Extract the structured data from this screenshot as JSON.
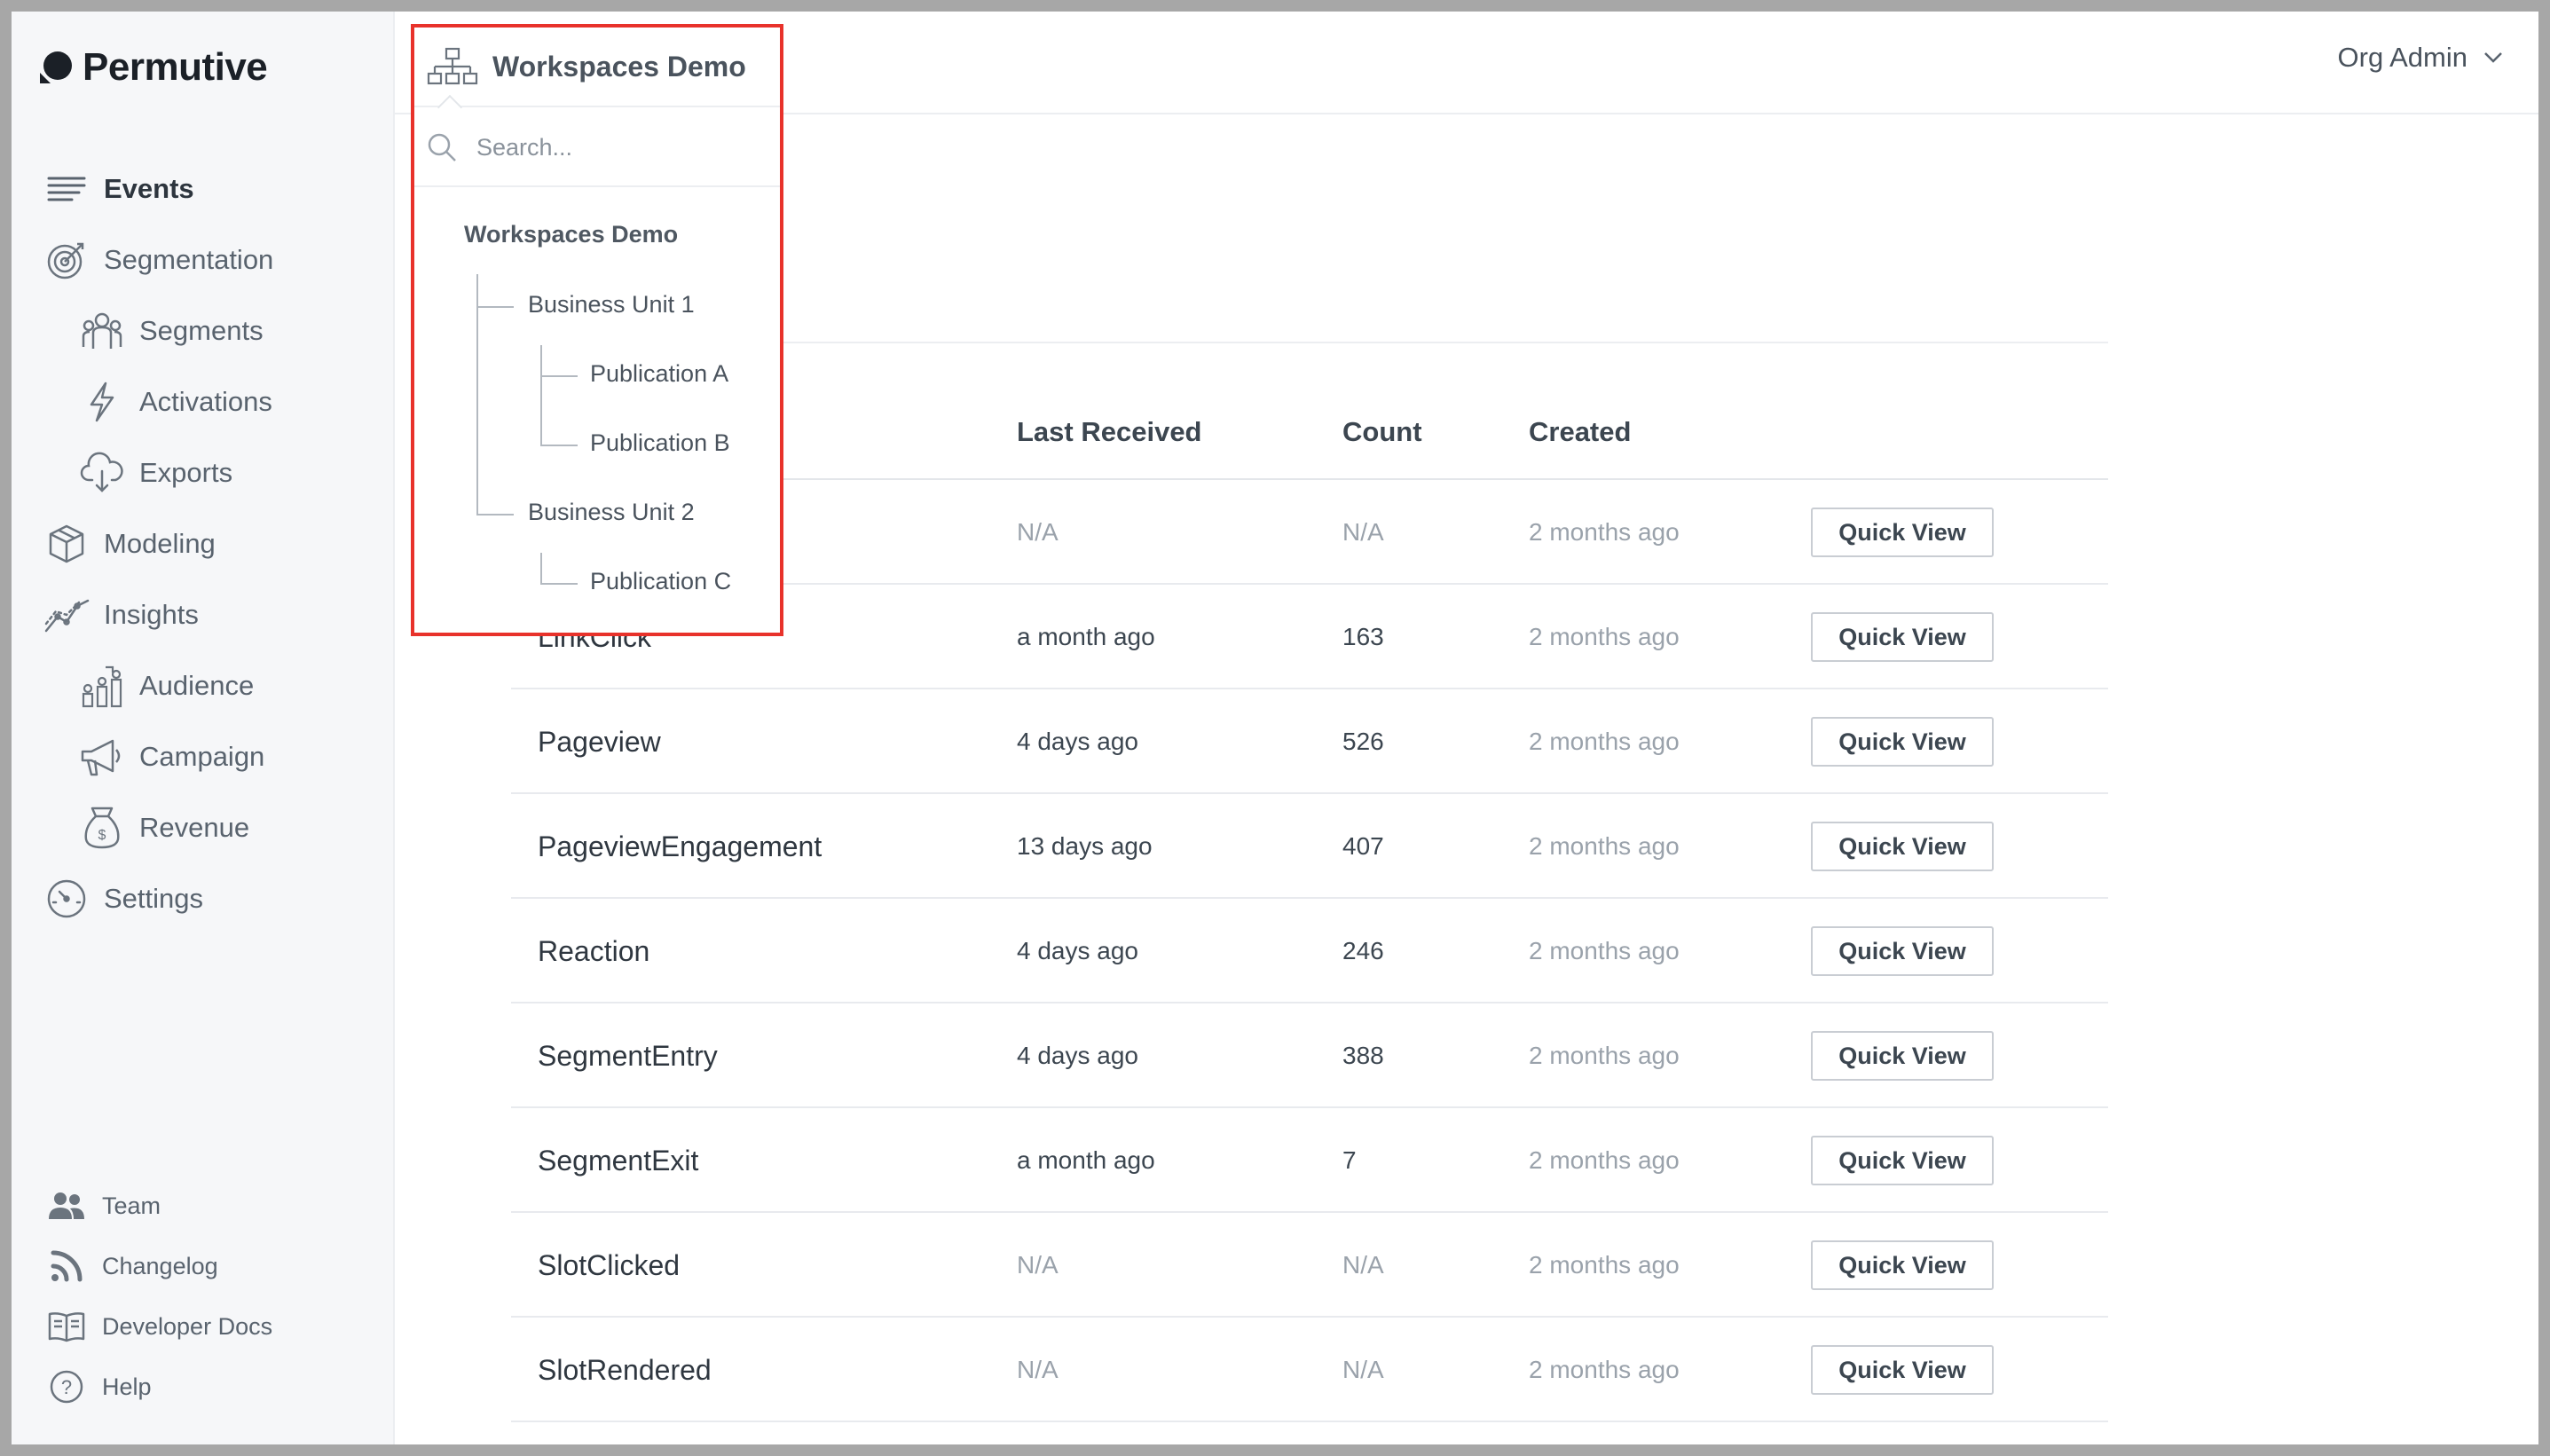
{
  "brand": {
    "name": "Permutive"
  },
  "sidebar": {
    "items": [
      {
        "label": "Events",
        "icon": "list-icon",
        "active": true
      },
      {
        "label": "Segmentation",
        "icon": "target-icon"
      },
      {
        "label": "Segments",
        "icon": "people-icon"
      },
      {
        "label": "Activations",
        "icon": "lightning-icon"
      },
      {
        "label": "Exports",
        "icon": "cloud-download-icon"
      },
      {
        "label": "Modeling",
        "icon": "cube-icon"
      },
      {
        "label": "Insights",
        "icon": "line-chart-icon"
      },
      {
        "label": "Audience",
        "icon": "audience-icon"
      },
      {
        "label": "Campaign",
        "icon": "megaphone-icon"
      },
      {
        "label": "Revenue",
        "icon": "money-bag-icon"
      },
      {
        "label": "Settings",
        "icon": "gauge-icon"
      }
    ],
    "bottom": [
      {
        "label": "Team",
        "icon": "team-icon"
      },
      {
        "label": "Changelog",
        "icon": "rss-icon"
      },
      {
        "label": "Developer Docs",
        "icon": "book-icon"
      },
      {
        "label": "Help",
        "icon": "help-icon"
      }
    ]
  },
  "header": {
    "org_label": "Org Admin"
  },
  "workspace": {
    "current": "Workspaces Demo",
    "search_placeholder": "Search...",
    "tree": {
      "root": "Workspaces Demo",
      "business_units": [
        {
          "label": "Business Unit 1",
          "publications": [
            "Publication A",
            "Publication B"
          ]
        },
        {
          "label": "Business Unit 2",
          "publications": [
            "Publication C"
          ]
        }
      ]
    }
  },
  "table": {
    "headers": {
      "last_received": "Last Received",
      "count": "Count",
      "created": "Created"
    },
    "action_label": "Quick View",
    "rows": [
      {
        "name": "",
        "last_received": "N/A",
        "count": "N/A",
        "created": "2 months ago"
      },
      {
        "name": "LinkClick",
        "last_received": "a month ago",
        "count": "163",
        "created": "2 months ago"
      },
      {
        "name": "Pageview",
        "last_received": "4 days ago",
        "count": "526",
        "created": "2 months ago"
      },
      {
        "name": "PageviewEngagement",
        "last_received": "13 days ago",
        "count": "407",
        "created": "2 months ago"
      },
      {
        "name": "Reaction",
        "last_received": "4 days ago",
        "count": "246",
        "created": "2 months ago"
      },
      {
        "name": "SegmentEntry",
        "last_received": "4 days ago",
        "count": "388",
        "created": "2 months ago"
      },
      {
        "name": "SegmentExit",
        "last_received": "a month ago",
        "count": "7",
        "created": "2 months ago"
      },
      {
        "name": "SlotClicked",
        "last_received": "N/A",
        "count": "N/A",
        "created": "2 months ago"
      },
      {
        "name": "SlotRendered",
        "last_received": "N/A",
        "count": "N/A",
        "created": "2 months ago"
      }
    ]
  }
}
